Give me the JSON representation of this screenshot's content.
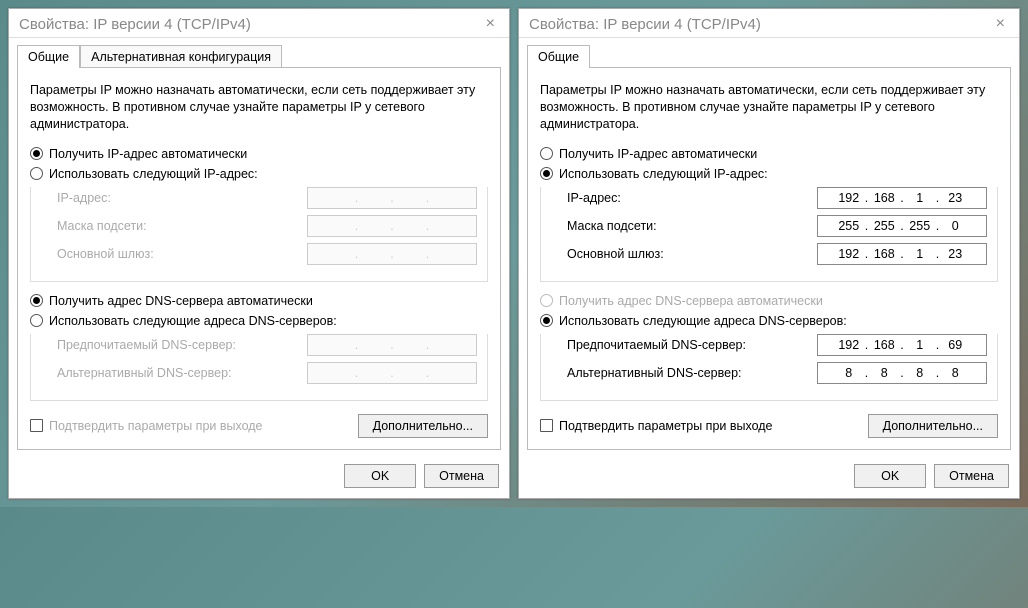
{
  "title": "Свойства: IP версии 4 (TCP/IPv4)",
  "tabs": {
    "general": "Общие",
    "alt": "Альтернативная конфигурация"
  },
  "intro": "Параметры IP можно назначать автоматически, если сеть поддерживает эту возможность. В противном случае узнайте параметры IP у сетевого администратора.",
  "radios": {
    "ip_auto": "Получить IP-адрес автоматически",
    "ip_manual": "Использовать следующий IP-адрес:",
    "dns_auto": "Получить адрес DNS-сервера автоматически",
    "dns_manual": "Использовать следующие адреса DNS-серверов:"
  },
  "labels": {
    "ip": "IP-адрес:",
    "mask": "Маска подсети:",
    "gateway": "Основной шлюз:",
    "dns1": "Предпочитаемый DNS-сервер:",
    "dns2": "Альтернативный DNS-сервер:",
    "validate": "Подтвердить параметры при выходе"
  },
  "buttons": {
    "advanced": "Дополнительно...",
    "ok": "OK",
    "cancel": "Отмена"
  },
  "right": {
    "ip": {
      "a": "192",
      "b": "168",
      "c": "1",
      "d": "23"
    },
    "mask": {
      "a": "255",
      "b": "255",
      "c": "255",
      "d": "0"
    },
    "gateway": {
      "a": "192",
      "b": "168",
      "c": "1",
      "d": "23"
    },
    "dns1": {
      "a": "192",
      "b": "168",
      "c": "1",
      "d": "69"
    },
    "dns2": {
      "a": "8",
      "b": "8",
      "c": "8",
      "d": "8"
    }
  }
}
